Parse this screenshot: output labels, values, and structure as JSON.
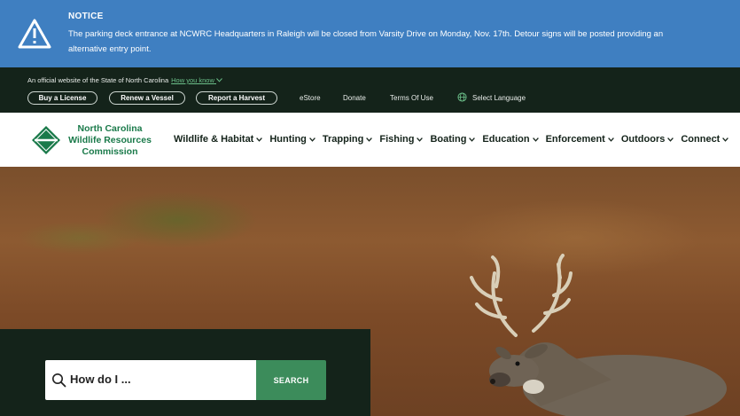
{
  "notice": {
    "title": "NOTICE",
    "body": "The parking deck entrance at NCWRC Headquarters in Raleigh will be closed from Varsity Drive on Monday, Nov. 17th. Detour signs will be posted providing an alternative entry point.",
    "icon": "warning-triangle-icon"
  },
  "utility": {
    "official_text": "An official website of the State of North Carolina",
    "how_you_know": "How you know",
    "buttons": [
      "Buy a License",
      "Renew a Vessel",
      "Report a Harvest"
    ],
    "links": [
      "eStore",
      "Donate",
      "Terms Of Use"
    ],
    "language": "Select Language"
  },
  "header": {
    "brand_line1": "North Carolina",
    "brand_line2": "Wildlife Resources",
    "brand_line3": "Commission",
    "nav": [
      "Wildlife & Habitat",
      "Hunting",
      "Trapping",
      "Fishing",
      "Boating",
      "Education",
      "Enforcement",
      "Outdoors",
      "Connect"
    ]
  },
  "search": {
    "placeholder": "How do I ...",
    "button": "SEARCH"
  },
  "colors": {
    "notice_bg": "#3f7fc1",
    "dark_green": "#14231a",
    "brand_green": "#1a7a4a",
    "search_button": "#3c8c5b"
  }
}
